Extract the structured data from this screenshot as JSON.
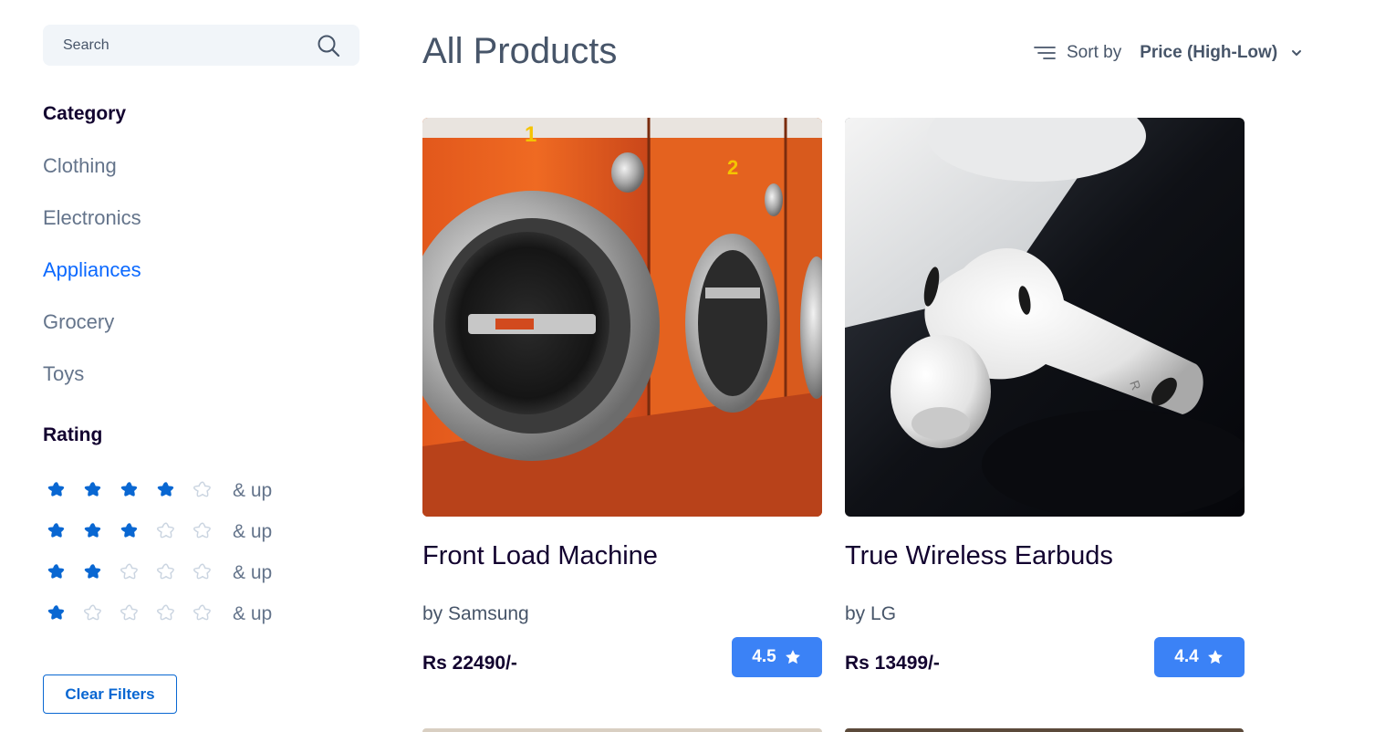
{
  "search": {
    "placeholder": "Search"
  },
  "category": {
    "heading": "Category",
    "items": [
      {
        "label": "Clothing",
        "active": false
      },
      {
        "label": "Electronics",
        "active": false
      },
      {
        "label": "Appliances",
        "active": true
      },
      {
        "label": "Grocery",
        "active": false
      },
      {
        "label": "Toys",
        "active": false
      }
    ]
  },
  "rating": {
    "heading": "Rating",
    "and_up_label": "& up",
    "rows": [
      {
        "filled": 4,
        "total": 5
      },
      {
        "filled": 3,
        "total": 5
      },
      {
        "filled": 2,
        "total": 5
      },
      {
        "filled": 1,
        "total": 5
      }
    ]
  },
  "clear_filters_label": "Clear Filters",
  "header": {
    "title": "All Products",
    "sort_label": "Sort by",
    "sort_value": "Price (High-Low)"
  },
  "products": [
    {
      "title": "Front Load Machine",
      "brand": "by Samsung",
      "price": "Rs 22490/-",
      "rating": "4.5",
      "image": "orange washing machines"
    },
    {
      "title": "True Wireless Earbuds",
      "brand": "by LG",
      "price": "Rs 13499/-",
      "rating": "4.4",
      "image": "white wireless earbud"
    }
  ],
  "colors": {
    "accent": "#0b69ff",
    "badge": "#3b82f6",
    "star_filled": "#0967d2",
    "star_empty": "#cbd5e1",
    "heading": "#12022f",
    "muted": "#64748b",
    "search_bg": "#f1f5f9"
  },
  "icons": {
    "search": "search-icon",
    "sort": "sort-lines-icon",
    "dropdown": "chevron-down-icon",
    "star": "star-icon"
  }
}
